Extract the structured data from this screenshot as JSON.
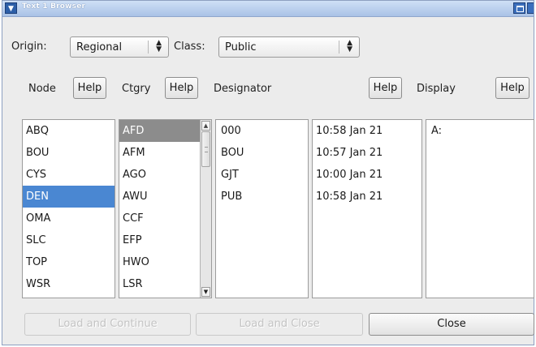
{
  "window": {
    "title": "Text 1 Browser"
  },
  "filters": {
    "origin_label": "Origin:",
    "origin_value": "Regional",
    "class_label": "Class:",
    "class_value": "Public"
  },
  "headers": {
    "node": "Node",
    "ctgry": "Ctgry",
    "designator": "Designator",
    "display": "Display",
    "help": "Help"
  },
  "lists": {
    "node": [
      "ABQ",
      "BOU",
      "CYS",
      "DEN",
      "OMA",
      "SLC",
      "TOP",
      "WSR"
    ],
    "node_selected": "DEN",
    "ctgry": [
      "AFD",
      "AFM",
      "AGO",
      "AWU",
      "CCF",
      "EFP",
      "HWO",
      "LSR"
    ],
    "ctgry_selected": "AFD",
    "designator": [
      "000",
      "BOU",
      "GJT",
      "PUB"
    ],
    "times": [
      "10:58 Jan 21",
      "10:57 Jan 21",
      "10:00 Jan 21",
      "10:58 Jan 21"
    ],
    "display": [
      "A:"
    ]
  },
  "buttons": {
    "load_continue": "Load and Continue",
    "load_close": "Load and Close",
    "close": "Close"
  },
  "colors": {
    "selection": "#4a87d2",
    "inactive_selection": "#8c8c8c",
    "titlebar": "#a9c2e6"
  }
}
